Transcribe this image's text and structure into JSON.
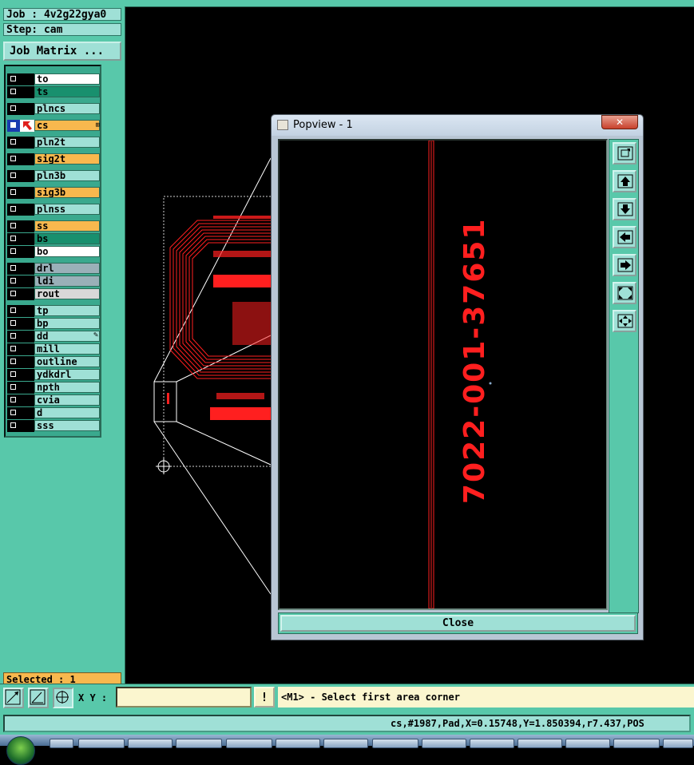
{
  "job": {
    "label": "Job : 4v2g22gya0",
    "step": "Step: cam",
    "matrix_button": "Job Matrix ..."
  },
  "layers": [
    {
      "name": "to",
      "color": "#ffffff",
      "mark": ""
    },
    {
      "name": "ts",
      "color": "#18906e",
      "mark": ""
    },
    {
      "name": "plncs",
      "color": "#9fe0d6",
      "mark": ""
    },
    {
      "name": "cs",
      "color": "#f8b84e",
      "mark": "arrow",
      "active": true
    },
    {
      "name": "pln2t",
      "color": "#9fe0d6",
      "mark": ""
    },
    {
      "name": "sig2t",
      "color": "#f8b84e",
      "mark": ""
    },
    {
      "name": "pln3b",
      "color": "#9fe0d6",
      "mark": ""
    },
    {
      "name": "sig3b",
      "color": "#f8b84e",
      "mark": ""
    },
    {
      "name": "plnss",
      "color": "#9fe0d6",
      "mark": ""
    },
    {
      "name": "ss",
      "color": "#f8b84e",
      "mark": ""
    },
    {
      "name": "bs",
      "color": "#18906e",
      "mark": ""
    },
    {
      "name": "bo",
      "color": "#ffffff",
      "mark": ""
    },
    {
      "name": "drl",
      "color": "#9ab0b8",
      "mark": ""
    },
    {
      "name": "ldi",
      "color": "#9ab0b8",
      "mark": ""
    },
    {
      "name": "rout",
      "color": "#d8d8d8",
      "mark": ""
    },
    {
      "name": "tp",
      "color": "#9fe0d6",
      "mark": ""
    },
    {
      "name": "bp",
      "color": "#9fe0d6",
      "mark": ""
    },
    {
      "name": "dd",
      "color": "#9fe0d6",
      "mark": "pen"
    },
    {
      "name": "mill",
      "color": "#9fe0d6",
      "mark": ""
    },
    {
      "name": "outline",
      "color": "#9fe0d6",
      "mark": ""
    },
    {
      "name": "ydkdrl",
      "color": "#9fe0d6",
      "mark": ""
    },
    {
      "name": "npth",
      "color": "#9fe0d6",
      "mark": ""
    },
    {
      "name": "cvia",
      "color": "#9fe0d6",
      "mark": ""
    },
    {
      "name": "d",
      "color": "#9fe0d6",
      "mark": ""
    },
    {
      "name": "sss",
      "color": "#9fe0d6",
      "mark": ""
    }
  ],
  "selected": "Selected : 1",
  "popup": {
    "title": "Popview - 1",
    "board_text": "7022-001-37651",
    "close_label": "Close",
    "tools": [
      "zoom-fit-icon",
      "pan-up-icon",
      "pan-down-icon",
      "pan-left-icon",
      "pan-right-icon",
      "zoom-out-icon",
      "zoom-in-icon"
    ]
  },
  "bottom": {
    "xy_label": "X Y :",
    "xy_value": "",
    "hint": "<M1> - Select first area corner",
    "warn_glyph": "!"
  },
  "status": "cs,#1987,Pad,X=0.15748,Y=1.850394,r7.437,POS",
  "colors": {
    "panel": "#58c8aa",
    "button": "#9fe0d6",
    "copper": "#ff1f1f",
    "highlight": "#f8b84e"
  }
}
